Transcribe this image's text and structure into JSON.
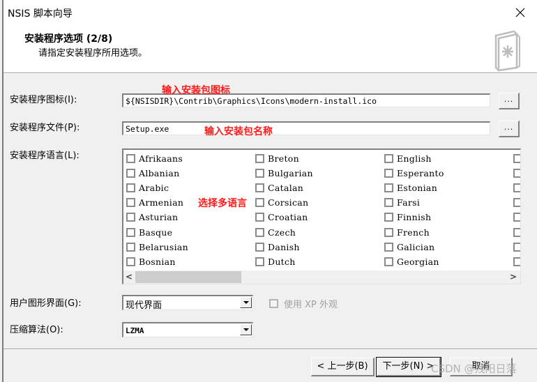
{
  "window": {
    "title": "NSIS 脚本向导",
    "close_icon": "close-icon"
  },
  "header": {
    "title": "安装程序选项 (2/8)",
    "subtitle": "请指定安装程序所用选项。",
    "icon": "installer-book-icon"
  },
  "fields": {
    "icon_label": "安装程序图标(I):",
    "icon_value": "${NSISDIR}\\Contrib\\Graphics\\Icons\\modern-install.ico",
    "file_label": "安装程序文件(P):",
    "file_value": "Setup.exe",
    "browse_label": "...",
    "language_label": "安装程序语言(L):",
    "ui_label": "用户图形界面(G):",
    "ui_value": "现代界面",
    "xp_style_label": "使用 XP 外观",
    "xp_style_checked": false,
    "compression_label": "压缩算法(O):",
    "compression_value": "LZMA"
  },
  "languages": {
    "columns": [
      [
        "Afrikaans",
        "Albanian",
        "Arabic",
        "Armenian",
        "Asturian",
        "Basque",
        "Belarusian",
        "Bosnian"
      ],
      [
        "Breton",
        "Bulgarian",
        "Catalan",
        "Corsican",
        "Croatian",
        "Czech",
        "Danish",
        "Dutch"
      ],
      [
        "English",
        "Esperanto",
        "Estonian",
        "Farsi",
        "Finnish",
        "French",
        "Galician",
        "Georgian"
      ]
    ],
    "checked": [],
    "scroll_left_icon": "<",
    "scroll_right_icon": ">"
  },
  "annotations": {
    "icon_note": "输入安装包图标",
    "name_note": "输入安装包名称",
    "lang_note": "选择多语言",
    "color": "#ff1a1a"
  },
  "buttons": {
    "back": "< 上一步(B)",
    "next": "下一步(N) >",
    "cancel": "取消"
  },
  "watermark": "CSDN @残阳日落"
}
